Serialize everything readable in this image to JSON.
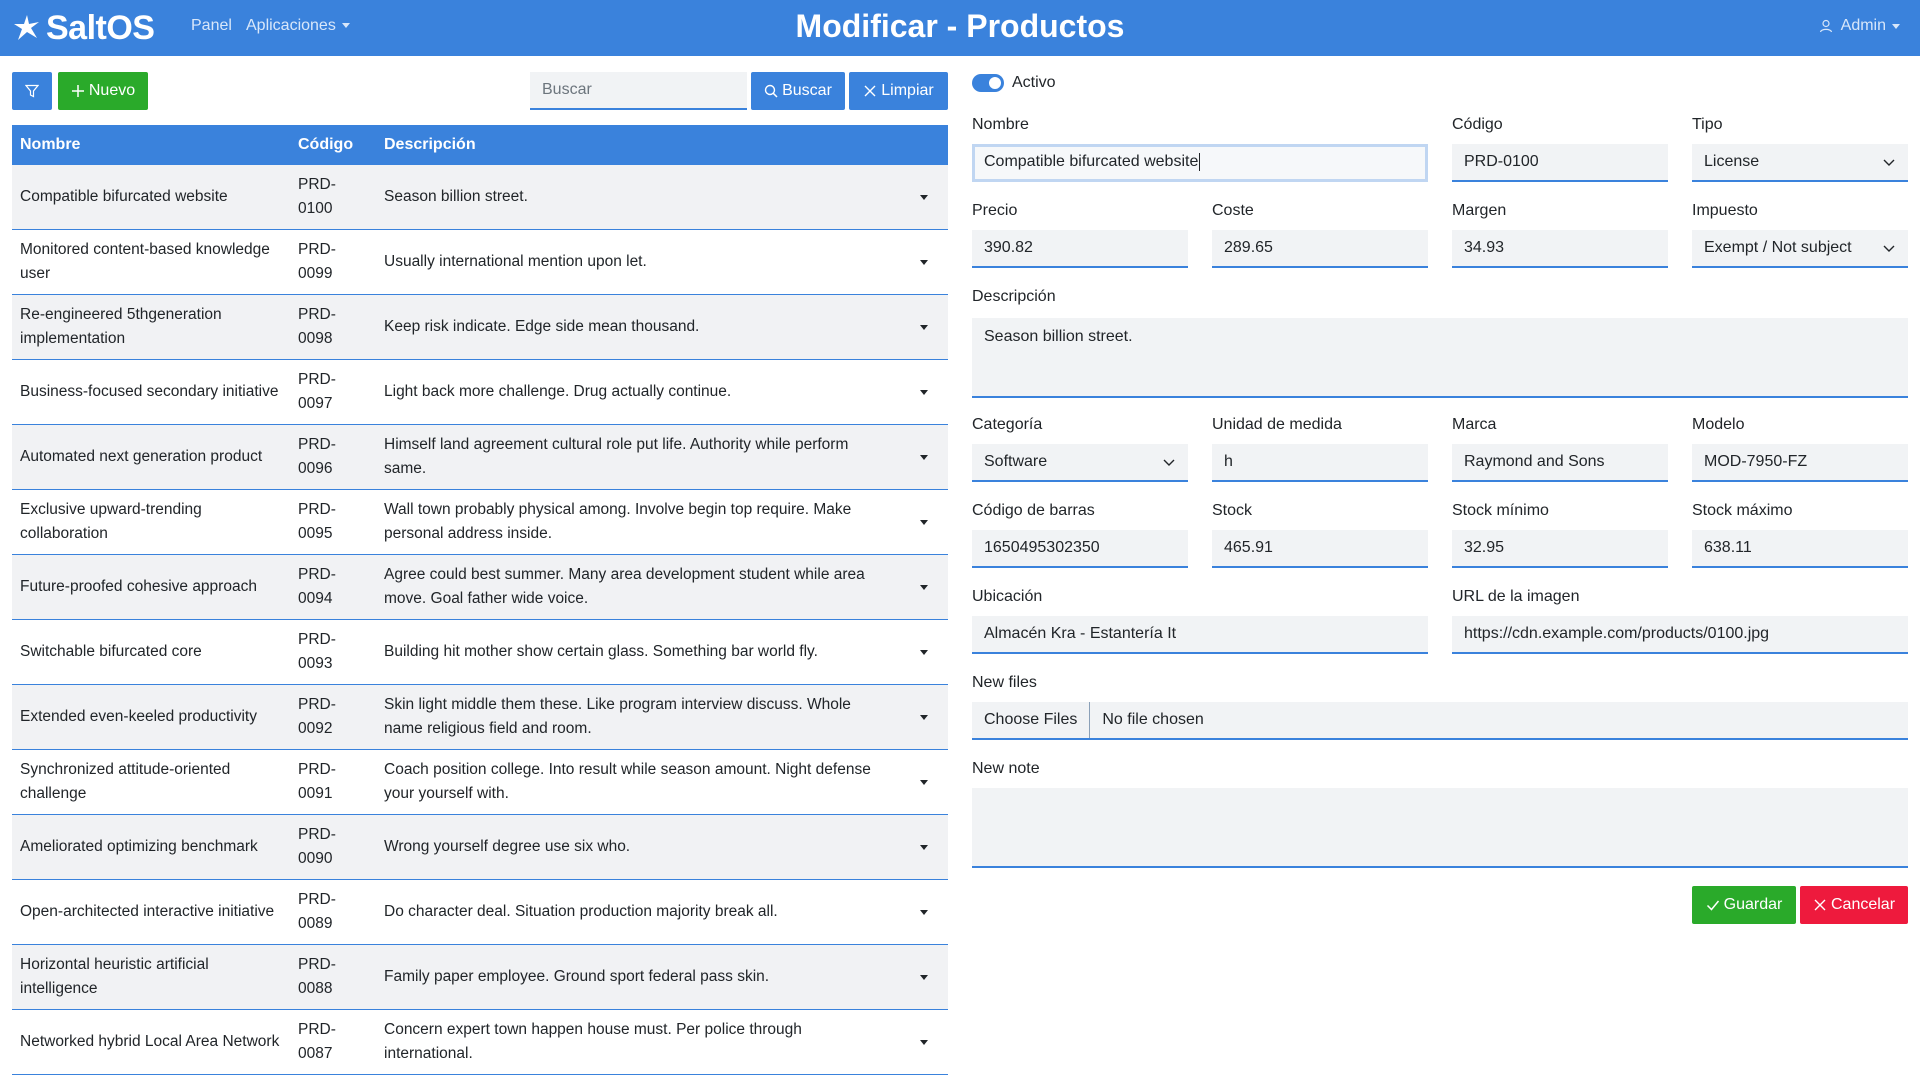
{
  "navbar": {
    "brand": "SaltOS",
    "panel": "Panel",
    "apps": "Aplicaciones",
    "title": "Modificar - Productos",
    "user": "Admin"
  },
  "toolbar": {
    "new_label": "Nuevo",
    "search_placeholder": "Buscar",
    "search_label": "Buscar",
    "clear_label": "Limpiar"
  },
  "table": {
    "headers": [
      "Nombre",
      "Código",
      "Descripción"
    ],
    "rows": [
      {
        "name": "Compatible bifurcated website",
        "code": "PRD-0100",
        "desc": "Season billion street."
      },
      {
        "name": "Monitored content-based knowledge user",
        "code": "PRD-0099",
        "desc": "Usually international mention upon let."
      },
      {
        "name": "Re-engineered 5thgeneration implementation",
        "code": "PRD-0098",
        "desc": "Keep risk indicate. Edge side mean thousand."
      },
      {
        "name": "Business-focused secondary initiative",
        "code": "PRD-0097",
        "desc": "Light back more challenge. Drug actually continue."
      },
      {
        "name": "Automated next generation product",
        "code": "PRD-0096",
        "desc": "Himself land agreement cultural role put life. Authority while perform same."
      },
      {
        "name": "Exclusive upward-trending collaboration",
        "code": "PRD-0095",
        "desc": "Wall town probably physical among. Involve begin top require. Make personal address inside."
      },
      {
        "name": "Future-proofed cohesive approach",
        "code": "PRD-0094",
        "desc": "Agree could best summer. Many area development student while area move. Goal father wide voice."
      },
      {
        "name": "Switchable bifurcated core",
        "code": "PRD-0093",
        "desc": "Building hit mother show certain glass. Something bar world fly."
      },
      {
        "name": "Extended even-keeled productivity",
        "code": "PRD-0092",
        "desc": "Skin light middle them these. Like program interview discuss. Whole name religious field and room."
      },
      {
        "name": "Synchronized attitude-oriented challenge",
        "code": "PRD-0091",
        "desc": "Coach position college. Into result while season amount. Night defense your yourself with."
      },
      {
        "name": "Ameliorated optimizing benchmark",
        "code": "PRD-0090",
        "desc": "Wrong yourself degree use six who."
      },
      {
        "name": "Open-architected interactive initiative",
        "code": "PRD-0089",
        "desc": "Do character deal. Situation production majority break all."
      },
      {
        "name": "Horizontal heuristic artificial intelligence",
        "code": "PRD-0088",
        "desc": "Family paper employee. Ground sport federal pass skin."
      },
      {
        "name": "Networked hybrid Local Area Network",
        "code": "PRD-0087",
        "desc": "Concern expert town happen house must. Per police through international."
      }
    ]
  },
  "form": {
    "active_label": "Activo",
    "name_label": "Nombre",
    "name_value": "Compatible bifurcated website",
    "code_label": "Código",
    "code_value": "PRD-0100",
    "type_label": "Tipo",
    "type_value": "License",
    "price_label": "Precio",
    "price_value": "390.82",
    "cost_label": "Coste",
    "cost_value": "289.65",
    "margin_label": "Margen",
    "margin_value": "34.93",
    "tax_label": "Impuesto",
    "tax_value": "Exempt / Not subject",
    "desc_label": "Descripción",
    "desc_value": "Season billion street.",
    "category_label": "Categoría",
    "category_value": "Software",
    "unit_label": "Unidad de medida",
    "unit_value": "h",
    "brand_label": "Marca",
    "brand_value": "Raymond and Sons",
    "model_label": "Modelo",
    "model_value": "MOD-7950-FZ",
    "barcode_label": "Código de barras",
    "barcode_value": "1650495302350",
    "stock_label": "Stock",
    "stock_value": "465.91",
    "stock_min_label": "Stock mínimo",
    "stock_min_value": "32.95",
    "stock_max_label": "Stock máximo",
    "stock_max_value": "638.11",
    "location_label": "Ubicación",
    "location_value": "Almacén Kra - Estantería It",
    "image_url_label": "URL de la imagen",
    "image_url_value": "https://cdn.example.com/products/0100.jpg",
    "files_label": "New files",
    "files_button": "Choose Files",
    "files_status": "No file chosen",
    "note_label": "New note",
    "save_label": "Guardar",
    "cancel_label": "Cancelar"
  }
}
